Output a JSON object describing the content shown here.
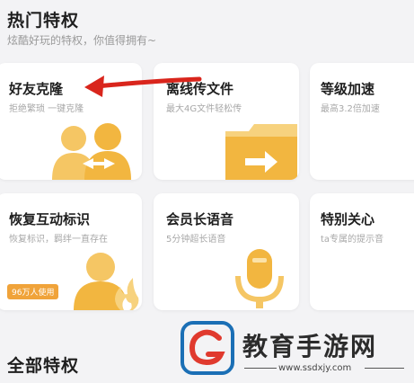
{
  "hot": {
    "title": "热门特权",
    "subtitle": "炫酷好玩的特权，你值得拥有~"
  },
  "cards": [
    {
      "title": "好友克隆",
      "desc": "拒绝繁琐 一键克隆",
      "icon": "friends-clone-icon"
    },
    {
      "title": "离线传文件",
      "desc": "最大4G文件轻松传",
      "icon": "folder-transfer-icon"
    },
    {
      "title": "等级加速",
      "desc": "最高3.2倍加速",
      "icon": "level-boost-icon"
    },
    {
      "title": "恢复互动标识",
      "desc": "恢复标识，羁绊一直存在",
      "badge": "96万人使用",
      "icon": "restore-badge-icon"
    },
    {
      "title": "会员长语音",
      "desc": "5分钟超长语音",
      "icon": "microphone-icon"
    },
    {
      "title": "特别关心",
      "desc": "ta专属的提示音",
      "icon": "special-care-icon"
    }
  ],
  "all": {
    "title": "全部特权"
  },
  "watermark": {
    "text": "教育手游网",
    "url": "www.ssdxjy.com"
  },
  "colors": {
    "accent_gold": "#f2b640",
    "arrow_red": "#d9251c",
    "watermark_red": "#e03a2e",
    "watermark_blue": "#1b6fb5"
  }
}
